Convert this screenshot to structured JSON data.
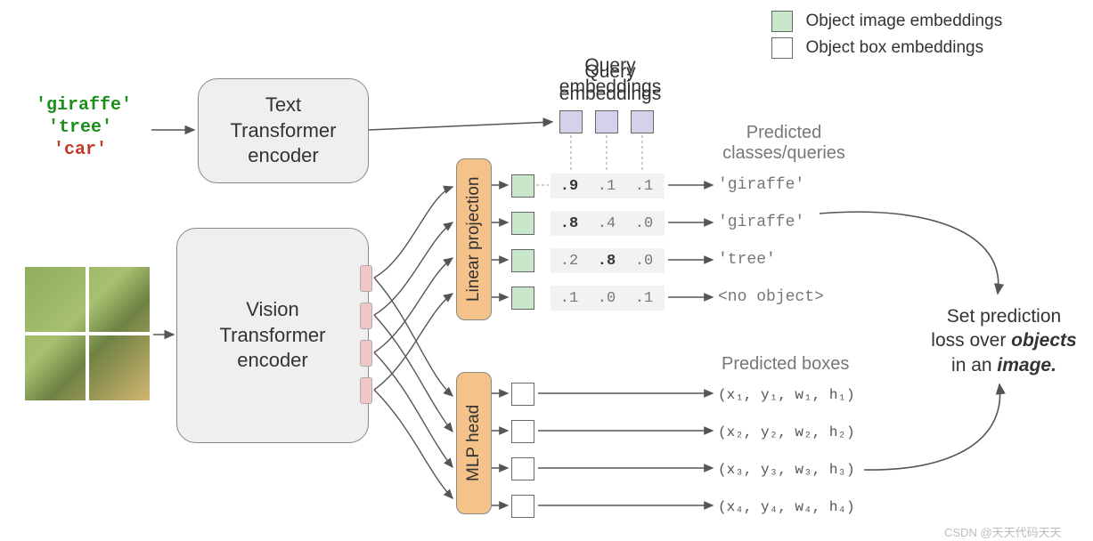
{
  "legend": {
    "image_emb": "Object image embeddings",
    "box_emb": "Object box embeddings"
  },
  "headings": {
    "query_emb": "Query embeddings",
    "pred_classes_l1": "Predicted",
    "pred_classes_l2": "classes/queries",
    "pred_boxes": "Predicted boxes"
  },
  "inputs": {
    "t1": "'giraffe'",
    "t2": "'tree'",
    "t3": "'car'"
  },
  "encoders": {
    "text_l1": "Text",
    "text_l2": "Transformer",
    "text_l3": "encoder",
    "vision_l1": "Vision",
    "vision_l2": "Transformer",
    "vision_l3": "encoder"
  },
  "projections": {
    "linear": "Linear projection",
    "mlp": "MLP head"
  },
  "scores": {
    "r1": {
      "a": ".9",
      "b": ".1",
      "c": ".1",
      "pred": "'giraffe'"
    },
    "r2": {
      "a": ".8",
      "b": ".4",
      "c": ".0",
      "pred": "'giraffe'"
    },
    "r3": {
      "a": ".2",
      "b": ".8",
      "c": ".0",
      "pred": "'tree'"
    },
    "r4": {
      "a": ".1",
      "b": ".0",
      "c": ".1",
      "pred": "<no object>"
    }
  },
  "boxes": {
    "b1": "(x₁, y₁, w₁, h₁)",
    "b2": "(x₂, y₂, w₂, h₂)",
    "b3": "(x₃, y₃, w₃, h₃)",
    "b4": "(x₄, y₄, w₄, h₄)"
  },
  "loss": {
    "l1": "Set prediction",
    "l2_a": "loss over ",
    "l2_b": "objects",
    "l3_a": "in an ",
    "l3_b": "image."
  },
  "watermark": "CSDN @天天代码天天"
}
